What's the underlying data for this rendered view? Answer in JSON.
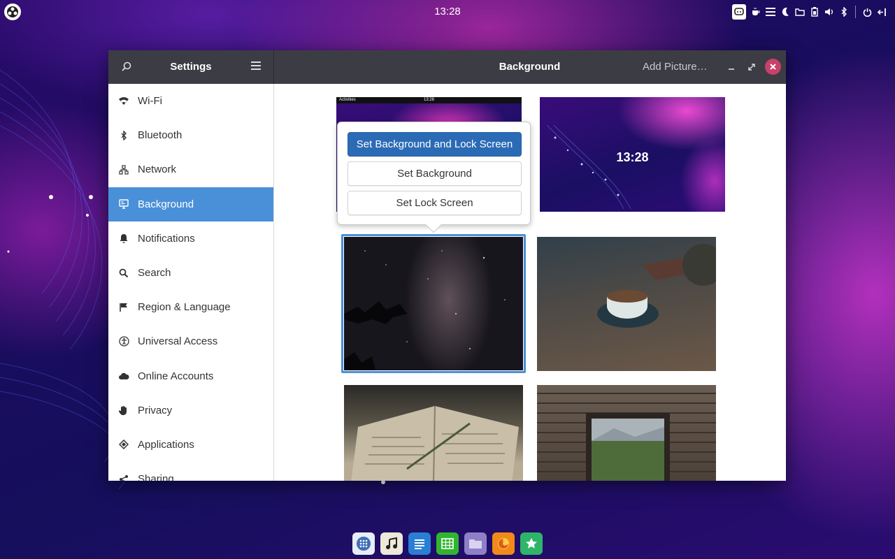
{
  "topbar": {
    "clock": "13:28",
    "tray_icons": [
      "chat-icon",
      "coffee-icon",
      "list-icon",
      "moon-icon",
      "folder-icon",
      "battery-icon",
      "volume-icon",
      "bluetooth-icon",
      "bell-icon",
      "power-icon",
      "exit-icon"
    ]
  },
  "window": {
    "sidebar_title": "Settings",
    "title": "Background",
    "add_picture": "Add Picture…"
  },
  "sidebar": {
    "items": [
      {
        "label": "Wi-Fi",
        "icon": "wifi-icon"
      },
      {
        "label": "Bluetooth",
        "icon": "bluetooth-icon"
      },
      {
        "label": "Network",
        "icon": "network-icon"
      },
      {
        "label": "Background",
        "icon": "background-icon",
        "active": true
      },
      {
        "label": "Notifications",
        "icon": "bell-icon"
      },
      {
        "label": "Search",
        "icon": "search-icon"
      },
      {
        "label": "Region & Language",
        "icon": "flag-icon"
      },
      {
        "label": "Universal Access",
        "icon": "accessibility-icon"
      },
      {
        "label": "Online Accounts",
        "icon": "cloud-icon"
      },
      {
        "label": "Privacy",
        "icon": "hand-icon"
      },
      {
        "label": "Applications",
        "icon": "applications-icon"
      },
      {
        "label": "Sharing",
        "icon": "share-icon"
      }
    ]
  },
  "preview": {
    "desktop_bar_label": "Activities",
    "desktop_clock": "13:28",
    "lock_clock": "13:28"
  },
  "popover": {
    "primary": "Set Background and Lock Screen",
    "background": "Set Background",
    "lock": "Set Lock Screen"
  },
  "colors": {
    "accent": "#4a90d9",
    "primary_button": "#2b6bb5",
    "close_button": "#c8416a",
    "headerbar": "#3c3c44"
  },
  "dock": [
    "apps-grid-icon",
    "music-icon",
    "text-editor-icon",
    "spreadsheet-icon",
    "files-icon",
    "firefox-icon",
    "software-icon"
  ]
}
